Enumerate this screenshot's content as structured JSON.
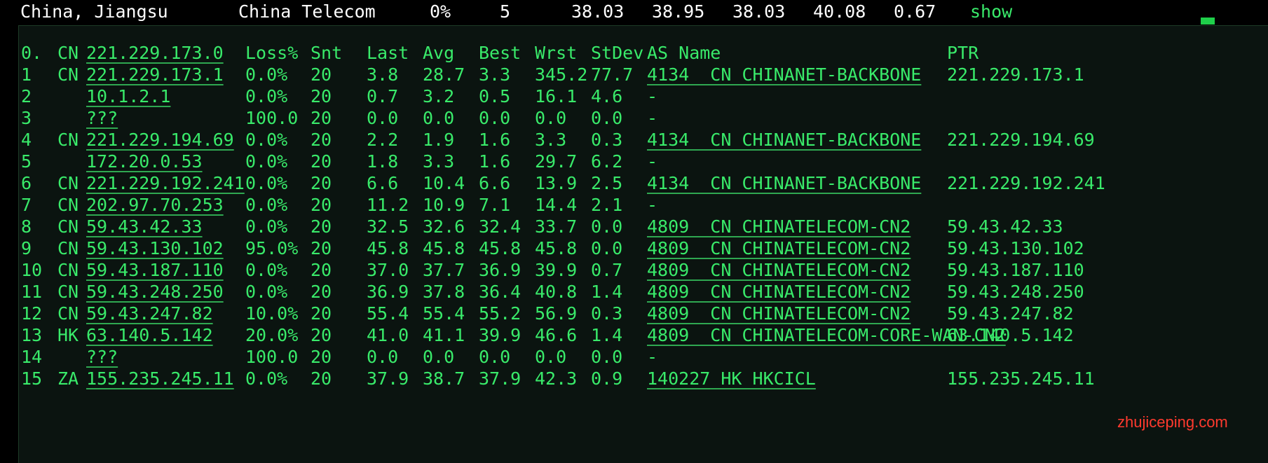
{
  "summary": {
    "location": "China, Jiangsu",
    "isp": "China Telecom",
    "loss": "0%",
    "sent": "5",
    "last": "38.03",
    "avg": "38.95",
    "best": "38.03",
    "worst": "40.08",
    "stdev": "0.67",
    "action_label": "show"
  },
  "table": {
    "header": {
      "hop": "0.",
      "cc": "CN",
      "ip": "221.229.173.0",
      "loss": "Loss%",
      "snt": "Snt",
      "last": "Last",
      "avg": "Avg",
      "best": "Best",
      "wrst": "Wrst",
      "stdev": "StDev",
      "as": "AS Name",
      "ptr": "PTR"
    },
    "rows": [
      {
        "hop": "1",
        "cc": "CN",
        "ip": "221.229.173.1",
        "loss": "0.0%",
        "snt": "20",
        "last": "3.8",
        "avg": "28.7",
        "best": "3.3",
        "wrst": "345.2",
        "stdev": "77.7",
        "as": "4134  CN CHINANET-BACKBONE",
        "ptr": "221.229.173.1"
      },
      {
        "hop": "2",
        "cc": "",
        "ip": "10.1.2.1",
        "loss": "0.0%",
        "snt": "20",
        "last": "0.7",
        "avg": "3.2",
        "best": "0.5",
        "wrst": "16.1",
        "stdev": "4.6",
        "as": "-",
        "ptr": ""
      },
      {
        "hop": "3",
        "cc": "",
        "ip": "???",
        "loss": "100.0",
        "snt": "20",
        "last": "0.0",
        "avg": "0.0",
        "best": "0.0",
        "wrst": "0.0",
        "stdev": "0.0",
        "as": "-",
        "ptr": ""
      },
      {
        "hop": "4",
        "cc": "CN",
        "ip": "221.229.194.69",
        "loss": "0.0%",
        "snt": "20",
        "last": "2.2",
        "avg": "1.9",
        "best": "1.6",
        "wrst": "3.3",
        "stdev": "0.3",
        "as": "4134  CN CHINANET-BACKBONE",
        "ptr": "221.229.194.69"
      },
      {
        "hop": "5",
        "cc": "",
        "ip": "172.20.0.53",
        "loss": "0.0%",
        "snt": "20",
        "last": "1.8",
        "avg": "3.3",
        "best": "1.6",
        "wrst": "29.7",
        "stdev": "6.2",
        "as": "-",
        "ptr": ""
      },
      {
        "hop": "6",
        "cc": "CN",
        "ip": "221.229.192.241",
        "loss": "0.0%",
        "snt": "20",
        "last": "6.6",
        "avg": "10.4",
        "best": "6.6",
        "wrst": "13.9",
        "stdev": "2.5",
        "as": "4134  CN CHINANET-BACKBONE",
        "ptr": "221.229.192.241"
      },
      {
        "hop": "7",
        "cc": "CN",
        "ip": "202.97.70.253",
        "loss": "0.0%",
        "snt": "20",
        "last": "11.2",
        "avg": "10.9",
        "best": "7.1",
        "wrst": "14.4",
        "stdev": "2.1",
        "as": "-",
        "ptr": ""
      },
      {
        "hop": "8",
        "cc": "CN",
        "ip": "59.43.42.33",
        "loss": "0.0%",
        "snt": "20",
        "last": "32.5",
        "avg": "32.6",
        "best": "32.4",
        "wrst": "33.7",
        "stdev": "0.0",
        "as": "4809  CN CHINATELECOM-CN2",
        "ptr": "59.43.42.33"
      },
      {
        "hop": "9",
        "cc": "CN",
        "ip": "59.43.130.102",
        "loss": "95.0%",
        "snt": "20",
        "last": "45.8",
        "avg": "45.8",
        "best": "45.8",
        "wrst": "45.8",
        "stdev": "0.0",
        "as": "4809  CN CHINATELECOM-CN2",
        "ptr": "59.43.130.102"
      },
      {
        "hop": "10",
        "cc": "CN",
        "ip": "59.43.187.110",
        "loss": "0.0%",
        "snt": "20",
        "last": "37.0",
        "avg": "37.7",
        "best": "36.9",
        "wrst": "39.9",
        "stdev": "0.7",
        "as": "4809  CN CHINATELECOM-CN2",
        "ptr": "59.43.187.110"
      },
      {
        "hop": "11",
        "cc": "CN",
        "ip": "59.43.248.250",
        "loss": "0.0%",
        "snt": "20",
        "last": "36.9",
        "avg": "37.8",
        "best": "36.4",
        "wrst": "40.8",
        "stdev": "1.4",
        "as": "4809  CN CHINATELECOM-CN2",
        "ptr": "59.43.248.250"
      },
      {
        "hop": "12",
        "cc": "CN",
        "ip": "59.43.247.82",
        "loss": "10.0%",
        "snt": "20",
        "last": "55.4",
        "avg": "55.4",
        "best": "55.2",
        "wrst": "56.9",
        "stdev": "0.3",
        "as": "4809  CN CHINATELECOM-CN2",
        "ptr": "59.43.247.82"
      },
      {
        "hop": "13",
        "cc": "HK",
        "ip": "63.140.5.142",
        "loss": "20.0%",
        "snt": "20",
        "last": "41.0",
        "avg": "41.1",
        "best": "39.9",
        "wrst": "46.6",
        "stdev": "1.4",
        "as": "4809  CN CHINATELECOM-CORE-WAN-CN2",
        "ptr": "63.140.5.142"
      },
      {
        "hop": "14",
        "cc": "",
        "ip": "???",
        "loss": "100.0",
        "snt": "20",
        "last": "0.0",
        "avg": "0.0",
        "best": "0.0",
        "wrst": "0.0",
        "stdev": "0.0",
        "as": "-",
        "ptr": ""
      },
      {
        "hop": "15",
        "cc": "ZA",
        "ip": "155.235.245.11",
        "loss": "0.0%",
        "snt": "20",
        "last": "37.9",
        "avg": "38.7",
        "best": "37.9",
        "wrst": "42.3",
        "stdev": "0.9",
        "as": "140227 HK HKCICL",
        "ptr": "155.235.245.11"
      }
    ]
  },
  "watermark": "zhujiceping.com"
}
